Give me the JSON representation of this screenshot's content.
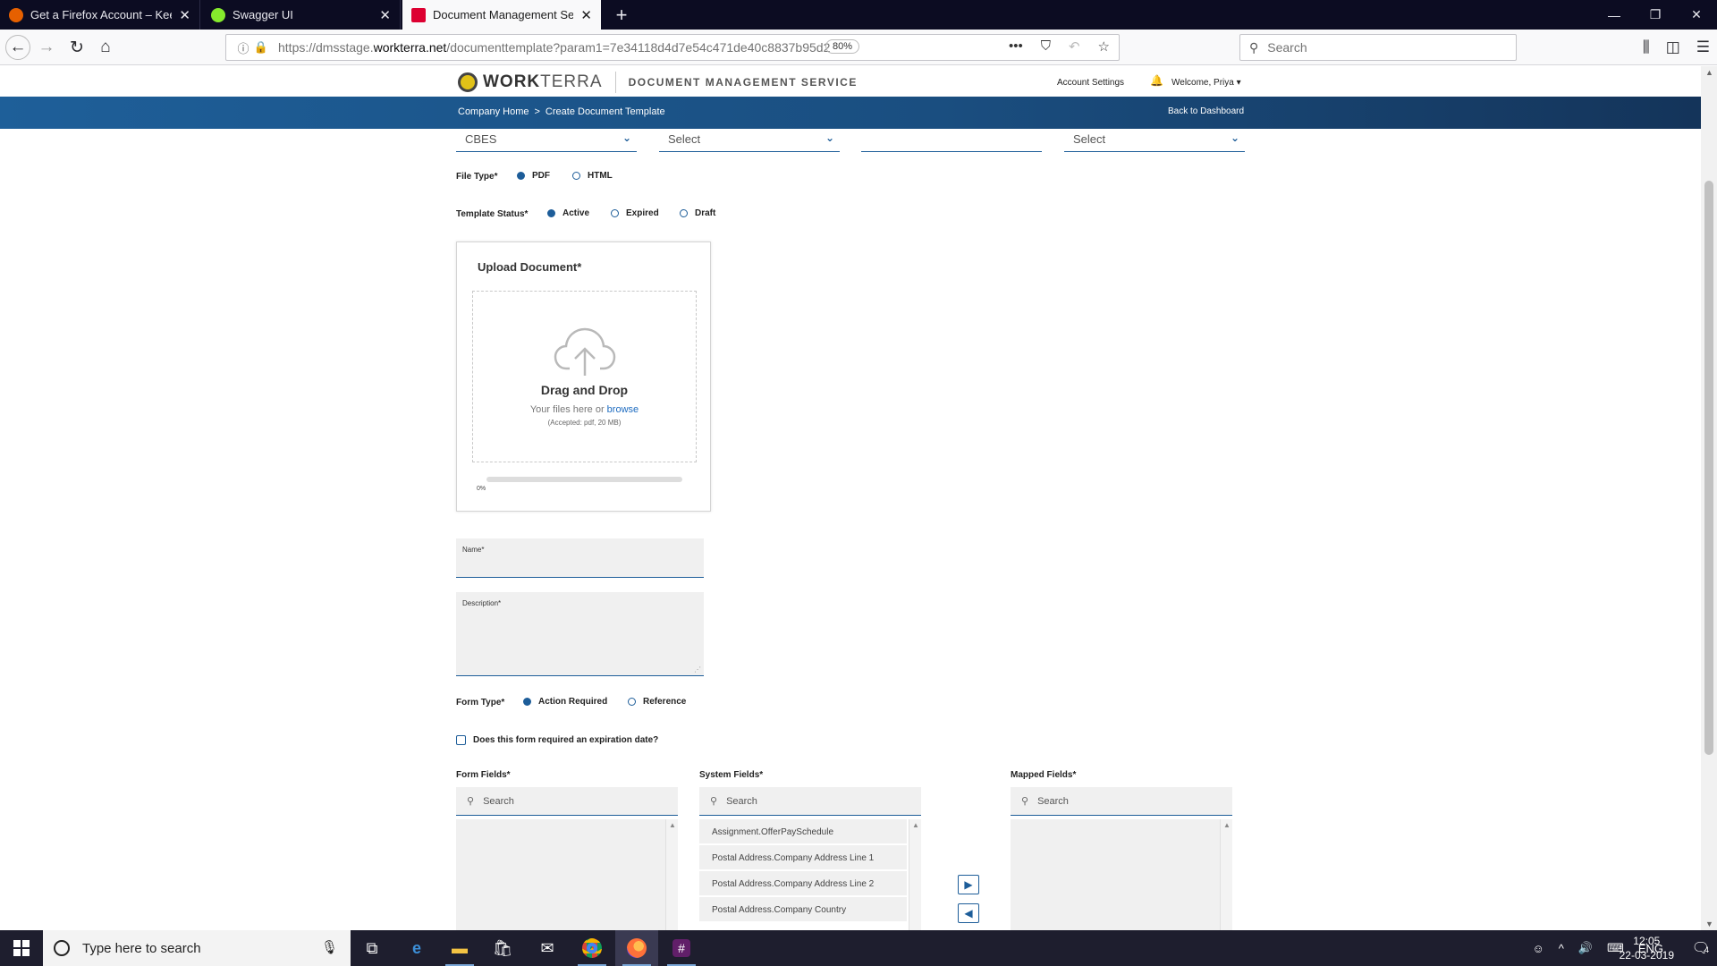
{
  "browser": {
    "tabs": [
      {
        "title": "Get a Firefox Account – Keep yo",
        "favicon_color": "#e66000",
        "active": false
      },
      {
        "title": "Swagger UI",
        "favicon_color": "#85ea2d",
        "active": false
      },
      {
        "title": "Document Management Servic",
        "favicon_color": "#dd0031",
        "active": true
      }
    ],
    "new_tab_icon": "plus-icon",
    "url_prefix": "https://dmsstage.",
    "url_domain": "workterra.net",
    "url_path": "/documenttemplate?param1=7e34118d4d7e54c471de40c8837b95d2",
    "zoom": "80%",
    "search_placeholder": "Search"
  },
  "app": {
    "logo_bold": "WORK",
    "logo_light": "TERRA",
    "service_name": "DOCUMENT MANAGEMENT SERVICE",
    "account_settings": "Account Settings",
    "welcome": "Welcome, Priya",
    "breadcrumb": {
      "home": "Company Home",
      "separator": ">",
      "current": "Create Document Template"
    },
    "back_to_dashboard": "Back to Dashboard",
    "accent_color": "#1d5d99"
  },
  "form": {
    "dropdowns": [
      {
        "value": "CBES"
      },
      {
        "value": "Select"
      },
      {
        "value": ""
      },
      {
        "value": "Select"
      }
    ],
    "file_type": {
      "label": "File Type*",
      "options": [
        "PDF",
        "HTML"
      ],
      "selected": "PDF"
    },
    "template_status": {
      "label": "Template Status*",
      "options": [
        "Active",
        "Expired",
        "Draft"
      ],
      "selected": "Active"
    },
    "upload": {
      "title": "Upload Document*",
      "drag_text": "Drag and Drop",
      "sub_text": "Your files here or ",
      "browse": "browse",
      "accepted": "(Accepted: pdf, 20 MB)",
      "progress": 0,
      "progress_label": "0%"
    },
    "name_label": "Name*",
    "description_label": "Description*",
    "form_type": {
      "label": "Form Type*",
      "options": [
        "Action Required",
        "Reference"
      ],
      "selected": "Action Required"
    },
    "expiration_question": "Does this form required an expiration date?",
    "form_fields": {
      "label": "Form Fields*",
      "search_placeholder": "Search",
      "items": []
    },
    "system_fields": {
      "label": "System Fields*",
      "search_placeholder": "Search",
      "items": [
        "Assignment.OfferPaySchedule",
        "Postal Address.Company Address Line 1",
        "Postal Address.Company Address Line 2",
        "Postal Address.Company Country"
      ]
    },
    "mapped_fields": {
      "label": "Mapped Fields*",
      "search_placeholder": "Search",
      "items": []
    }
  },
  "taskbar": {
    "search_placeholder": "Type here to search",
    "language": "ENG",
    "time": "12:05",
    "date": "22-03-2019",
    "notification_count": "4"
  }
}
